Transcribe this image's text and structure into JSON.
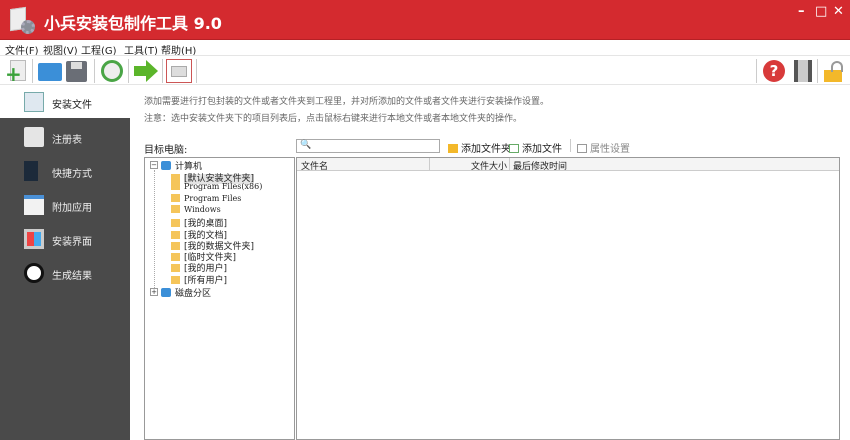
{
  "title": "小兵安装包制作工具 9.0",
  "window_controls": [
    "–",
    "□",
    "✕"
  ],
  "menu": [
    "文件(F)",
    "视图(V)",
    "工程(G)",
    "工具(T)",
    "帮助(H)"
  ],
  "sidebar": [
    {
      "label": "安装文件",
      "icon": "document-icon",
      "active": true
    },
    {
      "label": "注册表",
      "icon": "registry-gear-icon"
    },
    {
      "label": "快捷方式",
      "icon": "shortcut-icon"
    },
    {
      "label": "附加应用",
      "icon": "window-app-icon"
    },
    {
      "label": "安装界面",
      "icon": "ui-tiles-icon"
    },
    {
      "label": "生成结果",
      "icon": "alarm-clock-icon"
    }
  ],
  "main": {
    "desc1": "添加需要进行打包封装的文件或者文件夹到工程里，并对所添加的文件或者文件夹进行安装操作设置。",
    "desc2": "注意：选中安装文件夹下的项目列表后，点击鼠标右键来进行本地文件或者本地文件夹的操作。",
    "target_label": "目标电脑:",
    "search_value": "",
    "add_folder": "添加文件夹",
    "add_file": "添加文件",
    "properties": "属性设置",
    "tree": {
      "root": "计算机",
      "children": [
        "[默认安装文件夹]",
        "Program Files(x86)",
        "Program Files",
        "Windows",
        "[我的桌面]",
        "[我的文档]",
        "[我的数据文件夹]",
        "[临时文件夹]",
        "[我的用户]",
        "[所有用户]"
      ],
      "disk": "磁盘分区"
    },
    "columns": [
      "文件名",
      "文件大小",
      "最后修改时间"
    ]
  }
}
